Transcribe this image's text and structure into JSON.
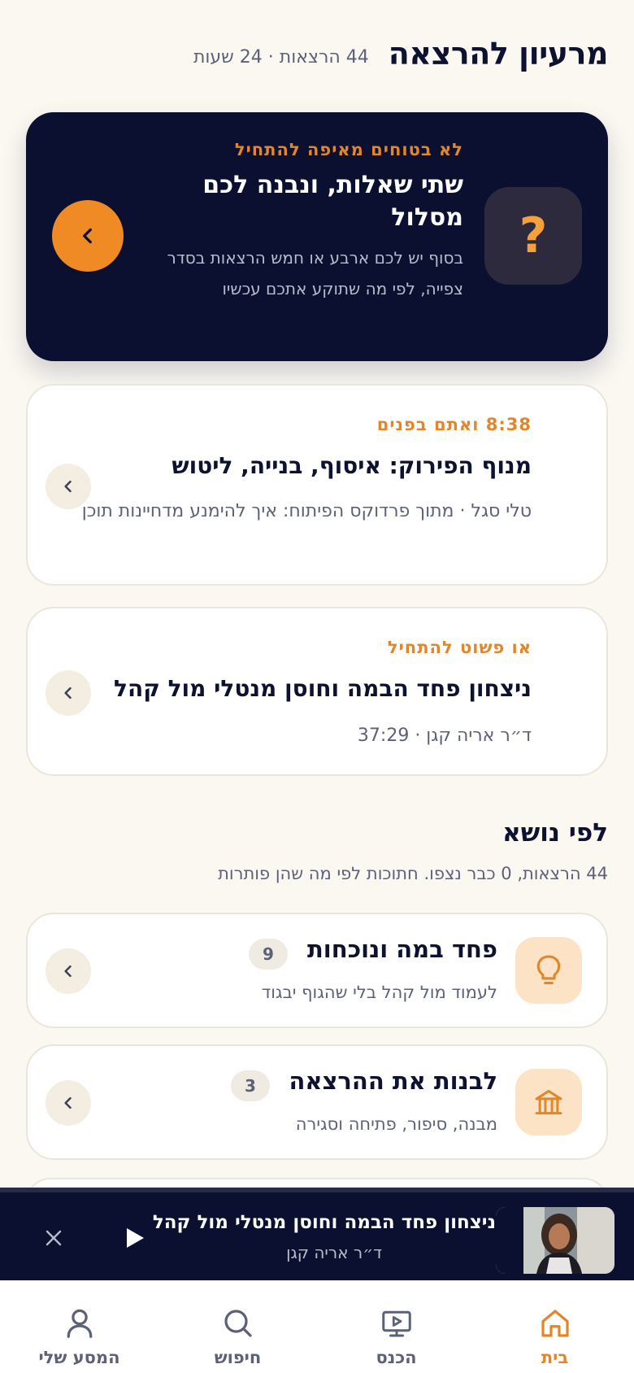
{
  "header": {
    "title": "מרעיון להרצאה",
    "meta": "44 הרצאות · 24 שעות"
  },
  "hero": {
    "eyebrow": "לא בטוחים מאיפה להתחיל",
    "title": "שתי שאלות, ונבנה לכם מסלול",
    "description": "בסוף יש לכם ארבע או חמש הרצאות בסדר צפייה, לפי מה שתוקע אתכם עכשיו",
    "icon": "question-mark-icon",
    "accent": "#f08a24"
  },
  "continue_card": {
    "eyebrow": "8:38 ואתם בפנים",
    "title": "מנוף הפירוק: איסוף, בנייה, ליטוש",
    "subtitle": "טלי סגל · מתוך פרדוקס הפיתוח: איך להימנע מדחיינות תוכן"
  },
  "start_card": {
    "eyebrow": "או פשוט להתחיל",
    "title": "ניצחון פחד הבמה וחוסן מנטלי מול קהל",
    "subtitle": "ד״ר אריה קגן · 37:29"
  },
  "topics_section": {
    "title": "לפי נושא",
    "subtitle": "44 הרצאות, 0 כבר נצפו. חתוכות לפי מה שהן פותרות"
  },
  "topics": [
    {
      "name": "פחד במה ונוכחות",
      "count": "9",
      "description": "לעמוד מול קהל בלי שהגוף יבגוד",
      "icon": "lightbulb-icon"
    },
    {
      "name": "לבנות את ההרצאה",
      "count": "3",
      "description": "מבנה, סיפור, פתיחה וסגירה",
      "icon": "building-icon"
    }
  ],
  "miniplayer": {
    "title": "ניצחון פחד הבמה וחוסן מנטלי מול קהל",
    "subtitle": "ד״ר אריה קגן"
  },
  "tabbar": {
    "home": "בית",
    "conference": "הכנס",
    "search": "חיפוש",
    "journey": "המסע שלי"
  },
  "colors": {
    "navy": "#0b1030",
    "orange": "#f08a24",
    "background": "#fbf8f2"
  }
}
